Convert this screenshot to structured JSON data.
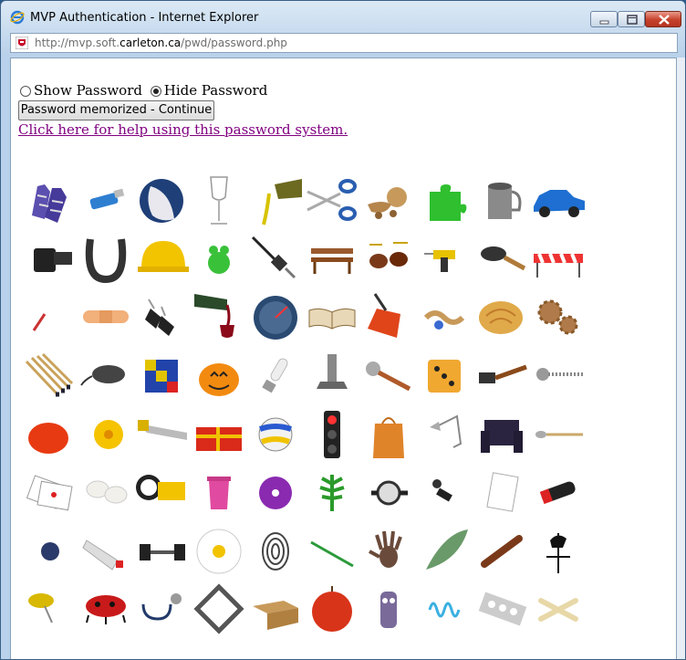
{
  "window": {
    "title": "MVP Authentication - Internet Explorer",
    "controls": [
      "minimize-icon",
      "maximize-icon",
      "close-icon"
    ]
  },
  "address_bar": {
    "url_prefix": "http://mvp.soft.",
    "url_domain": "carleton.ca",
    "url_path": "/pwd/password.php"
  },
  "password_options": {
    "show_label": "Show Password",
    "hide_label": "Hide Password",
    "selected": "hide"
  },
  "continue_button": {
    "label": "Password memorized - Continue"
  },
  "help_link": {
    "text": "Click here for help using this password system."
  },
  "image_grid": {
    "rows": [
      [
        "gloves-icon",
        "usb-drive-icon",
        "globe-icon",
        "wine-glass-icon",
        "oil-bottle-icon",
        "scissors-icon",
        "wooden-toy-icon",
        "puzzle-piece-icon",
        "metal-mug-icon",
        "blue-car-icon"
      ],
      [
        "film-canister-icon",
        "horseshoe-icon",
        "hard-hat-icon",
        "frog-icon",
        "power-plug-icon",
        "bench-icon",
        "drum-set-icon",
        "power-drill-icon",
        "hair-brush-icon",
        "road-barrier-icon"
      ],
      [
        "pencil-icon",
        "bandage-icon",
        "binder-clips-icon",
        "wine-pour-icon",
        "speedometer-icon",
        "open-book-icon",
        "dustpan-icon",
        "pencil-shavings-icon",
        "bread-roll-icon",
        "gears-icon"
      ],
      [
        "matches-icon",
        "computer-mouse-icon",
        "rubiks-cube-icon",
        "pumpkin-icon",
        "light-bulb-icon",
        "bolt-nut-icon",
        "ice-cream-scoop-icon",
        "dice-icon",
        "hammer-icon",
        "screw-icon"
      ],
      [
        "tomato-icon",
        "daisy-flower-icon",
        "hand-saw-icon",
        "gift-box-icon",
        "volleyball-icon",
        "traffic-light-icon",
        "paper-bag-icon",
        "desk-lamp-icon",
        "armchair-icon",
        "spoon-icon"
      ],
      [
        "playing-cards-icon",
        "mushrooms-icon",
        "flashlight-icon",
        "trash-bin-icon",
        "compact-disc-icon",
        "leaf-icon",
        "wristwatch-icon",
        "rubber-stamp-icon",
        "notepad-icon",
        "lighter-icon"
      ],
      [
        "blueberry-icon",
        "paint-tube-icon",
        "dumbbell-icon",
        "white-daisy-icon",
        "fingerprint-icon",
        "paintbrush-icon",
        "handprint-icon",
        "feather-icon",
        "cigar-icon",
        "weather-vane-icon"
      ],
      [
        "pushpin-icon",
        "ladybug-icon",
        "stethoscope-icon",
        "picture-frame-icon",
        "cardboard-box-icon",
        "apple-icon",
        "sock-puppet-icon",
        "spring-coil-icon",
        "pill-pack-icon",
        "dog-bone-icon"
      ]
    ]
  }
}
